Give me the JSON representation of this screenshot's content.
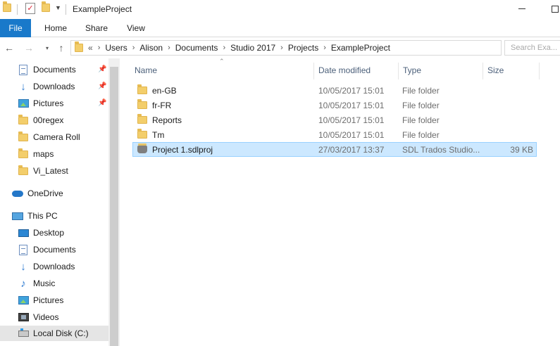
{
  "window": {
    "title": "ExampleProject"
  },
  "ribbon": {
    "tabs": [
      "File",
      "Home",
      "Share",
      "View"
    ]
  },
  "address": {
    "overflow": "«",
    "crumbs": [
      "Users",
      "Alison",
      "Documents",
      "Studio 2017",
      "Projects",
      "ExampleProject"
    ],
    "search_placeholder": "Search Exa..."
  },
  "nav": {
    "quick_access": [
      {
        "label": "Documents",
        "icon": "documents-icon",
        "pinned": true
      },
      {
        "label": "Downloads",
        "icon": "downloads-icon",
        "pinned": true
      },
      {
        "label": "Pictures",
        "icon": "pictures-icon",
        "pinned": true
      },
      {
        "label": "00regex",
        "icon": "folder-icon",
        "pinned": false
      },
      {
        "label": "Camera Roll",
        "icon": "folder-icon",
        "pinned": false
      },
      {
        "label": "maps",
        "icon": "folder-icon",
        "pinned": false
      },
      {
        "label": "Vi_Latest",
        "icon": "folder-icon",
        "pinned": false
      }
    ],
    "onedrive": "OneDrive",
    "thispc": "This PC",
    "pc_items": [
      {
        "label": "Desktop",
        "icon": "desktop-icon"
      },
      {
        "label": "Documents",
        "icon": "documents-icon"
      },
      {
        "label": "Downloads",
        "icon": "downloads-icon"
      },
      {
        "label": "Music",
        "icon": "music-icon"
      },
      {
        "label": "Pictures",
        "icon": "pictures-icon"
      },
      {
        "label": "Videos",
        "icon": "videos-icon"
      },
      {
        "label": "Local Disk (C:)",
        "icon": "disk-icon"
      }
    ]
  },
  "columns": {
    "name": "Name",
    "date": "Date modified",
    "type": "Type",
    "size": "Size"
  },
  "files": [
    {
      "name": "en-GB",
      "date": "10/05/2017 15:01",
      "type": "File folder",
      "size": ""
    },
    {
      "name": "fr-FR",
      "date": "10/05/2017 15:01",
      "type": "File folder",
      "size": ""
    },
    {
      "name": "Reports",
      "date": "10/05/2017 15:01",
      "type": "File folder",
      "size": ""
    },
    {
      "name": "Tm",
      "date": "10/05/2017 15:01",
      "type": "File folder",
      "size": ""
    },
    {
      "name": "Project 1.sdlproj",
      "date": "27/03/2017 13:37",
      "type": "SDL Trados Studio...",
      "size": "39 KB"
    }
  ],
  "colors": {
    "accent": "#1979ca",
    "selection": "#cce8ff",
    "selection_border": "#99d1ff"
  }
}
